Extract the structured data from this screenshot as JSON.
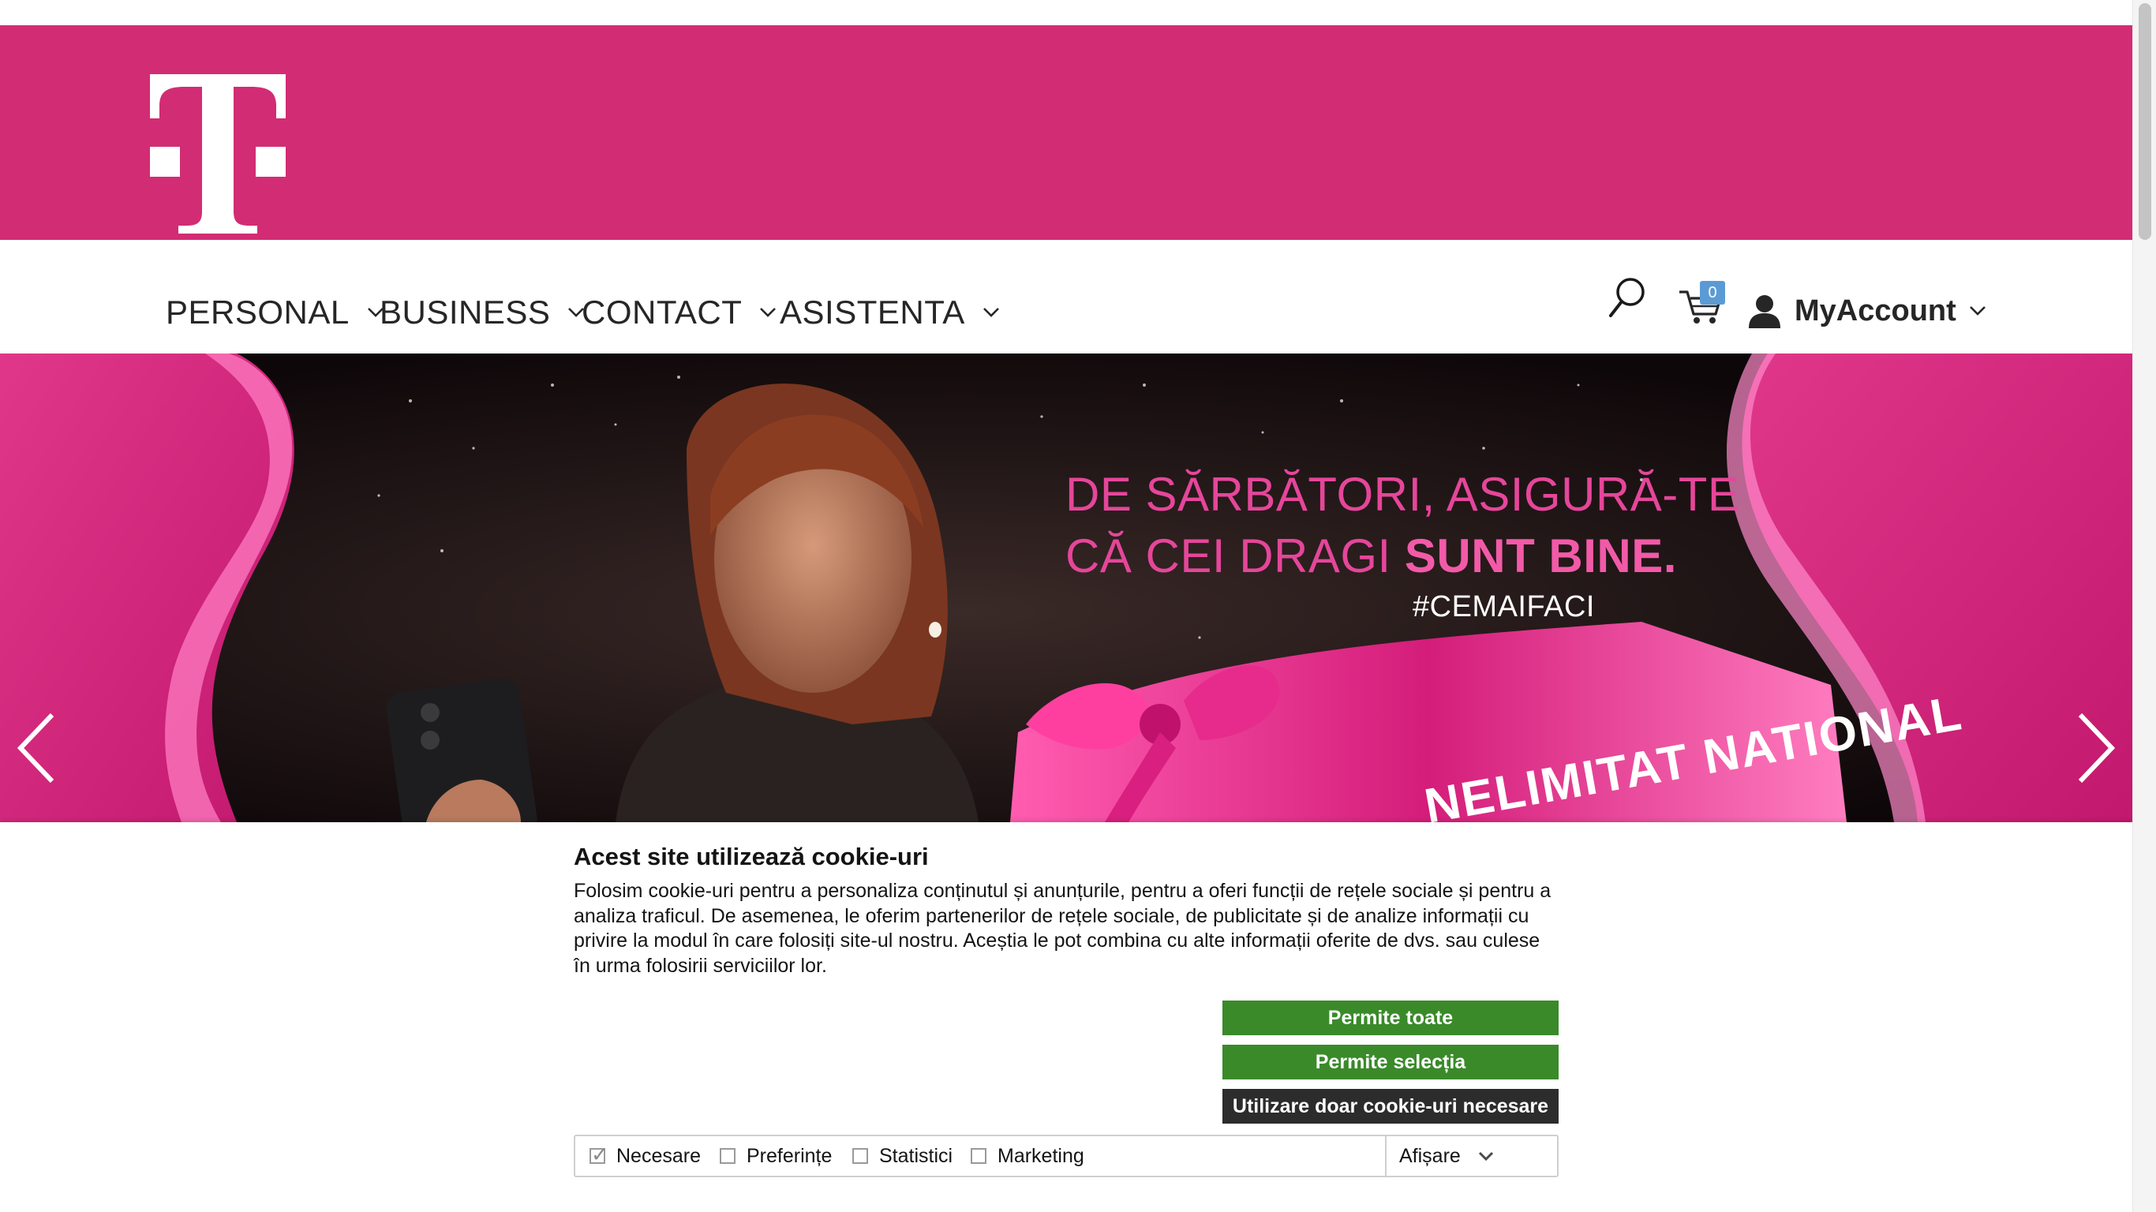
{
  "brand": {
    "logo_icon": "telekom-t-logo",
    "color_magenta": "#d22c74"
  },
  "nav": {
    "items": [
      {
        "label": "PERSONAL"
      },
      {
        "label": "BUSINESS"
      },
      {
        "label": "CONTACT"
      },
      {
        "label": "ASISTENTA"
      }
    ],
    "search_icon": "search-icon",
    "cart_count": "0",
    "account_label": "MyAccount"
  },
  "hero": {
    "title_line1": "DE SĂRBĂTORI, ASIGURĂ-TE",
    "title_line2_regular": "CĂ CEI DRAGI ",
    "title_line2_bold": "SUNT BINE.",
    "hashtag": "#CEMAIFACI",
    "tag_text": "NELIMITAT NATIONAL",
    "prev_icon": "chevron-left-icon",
    "next_icon": "chevron-right-icon"
  },
  "cookie": {
    "title": "Acest site utilizează cookie-uri",
    "text": "Folosim cookie-uri pentru a personaliza conținutul și anunțurile, pentru a oferi funcții de rețele sociale și pentru a analiza traficul. De asemenea, le oferim partenerilor de rețele sociale, de publicitate și de analize informații cu privire la modul în care folosiți site-ul nostru. Aceștia le pot combina cu alte informații oferite de dvs. sau culese în urma folosirii serviciilor lor.",
    "btn_allow_all": "Permite toate",
    "btn_allow_selection": "Permite selecția",
    "btn_necessary_only": "Utilizare doar cookie-uri necesare",
    "options": [
      {
        "label": "Necesare",
        "checked": true
      },
      {
        "label": "Preferințe",
        "checked": false
      },
      {
        "label": "Statistici",
        "checked": false
      },
      {
        "label": "Marketing",
        "checked": false
      }
    ],
    "details_label": "Afișare",
    "accent_green": "#3a8a2a",
    "accent_dark": "#2c2c2c"
  }
}
